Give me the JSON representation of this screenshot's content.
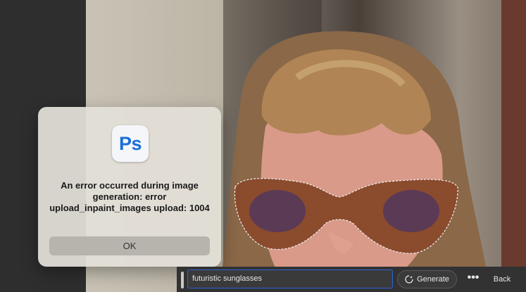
{
  "dialog": {
    "app_icon_text": "Ps",
    "message": "An error occurred during image generation: error upload_inpaint_images upload: 1004",
    "ok_label": "OK"
  },
  "contextual_bar": {
    "prompt_value": "futuristic sunglasses",
    "generate_label": "Generate",
    "more_label": "•••",
    "back_label": "Back"
  },
  "colors": {
    "accent": "#2d63d6",
    "ps_blue": "#1b6fd8"
  }
}
